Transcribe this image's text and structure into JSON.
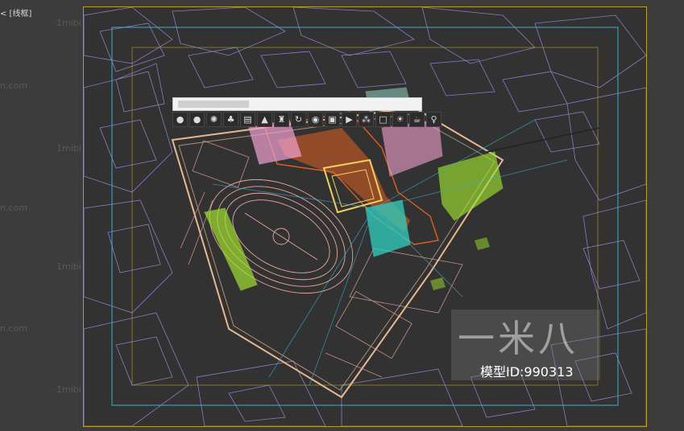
{
  "viewport": {
    "label": "[+] [顶] [线框]",
    "label_visible": "< [线框]",
    "watermark_side": "1mibi",
    "watermark_side_com": "n.com"
  },
  "toolbar": {
    "title_text": "",
    "icons": [
      {
        "name": "pin-icon",
        "glyph": "●"
      },
      {
        "name": "sphere-icon",
        "glyph": "●"
      },
      {
        "name": "particles-icon",
        "glyph": "✺"
      },
      {
        "name": "trees-icon",
        "glyph": "♣"
      },
      {
        "name": "list-icon",
        "glyph": "▤"
      },
      {
        "name": "rocket-icon",
        "glyph": "▲"
      },
      {
        "name": "bottle-icon",
        "glyph": "♜"
      },
      {
        "name": "refresh-icon",
        "glyph": "↻"
      },
      {
        "name": "globe-icon",
        "glyph": "◉"
      },
      {
        "name": "frame-icon",
        "glyph": "▣"
      },
      {
        "name": "play-icon",
        "glyph": "▶"
      },
      {
        "name": "grass-icon",
        "glyph": "⁂"
      },
      {
        "name": "square-icon",
        "glyph": "□"
      },
      {
        "name": "light-icon",
        "glyph": "☀"
      },
      {
        "name": "teapot-icon",
        "glyph": "☕"
      },
      {
        "name": "bulb-icon",
        "glyph": "♀"
      }
    ]
  },
  "watermark": {
    "logo": "一米八",
    "model_id": "模型ID:990313"
  },
  "colors": {
    "frame_border": "#b8a020",
    "wire_purple": "#9a8ad8",
    "wire_orange": "#e06020",
    "wire_pink": "#f0a0d0",
    "wire_green": "#a0e030",
    "wire_teal": "#30d0c0",
    "wire_yellow": "#f0d060",
    "wire_tan": "#e8b890",
    "wire_cyan": "#3ab0d0"
  }
}
